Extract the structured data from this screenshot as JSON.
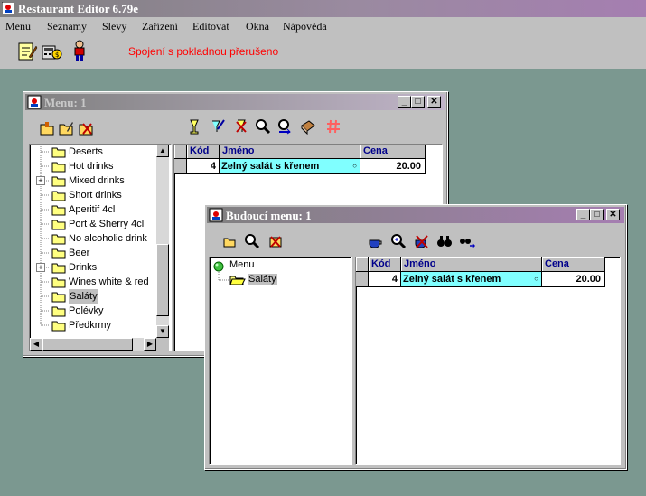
{
  "app": {
    "title": "Restaurant Editor 6.79e"
  },
  "menubar": [
    "Menu",
    "Seznamy",
    "Slevy",
    "Zařízení",
    "Editovat",
    "Okna",
    "Nápověda"
  ],
  "status_text": "Spojení s pokladnou přerušeno",
  "main_toolbar_icons": [
    "notepad-icon",
    "cash-register-icon",
    "user-icon"
  ],
  "menu_window": {
    "title": "Menu: 1",
    "tree": [
      {
        "label": "Deserts",
        "expandable": false
      },
      {
        "label": "Hot drinks",
        "expandable": false
      },
      {
        "label": "Mixed drinks",
        "expandable": true
      },
      {
        "label": "Short drinks",
        "expandable": false
      },
      {
        "label": "Aperitif 4cl",
        "expandable": false
      },
      {
        "label": "Port & Sherry 4cl",
        "expandable": false
      },
      {
        "label": "No alcoholic drink",
        "expandable": false
      },
      {
        "label": "Beer",
        "expandable": false
      },
      {
        "label": "Drinks",
        "expandable": true
      },
      {
        "label": "Wines white & red",
        "expandable": false
      },
      {
        "label": "Saláty",
        "expandable": false,
        "selected": true
      },
      {
        "label": "Polévky",
        "expandable": false
      },
      {
        "label": "Předkrmy",
        "expandable": false
      }
    ],
    "columns": [
      "Kód",
      "Jméno",
      "Cena"
    ],
    "rows": [
      {
        "kod": "4",
        "jmeno": "Zelný salát s křenem",
        "cena": "20.00"
      }
    ]
  },
  "future_window": {
    "title": "Budoucí menu: 1",
    "tree_root": "Menu",
    "tree_child": "Saláty",
    "columns": [
      "Kód",
      "Jméno",
      "Cena"
    ],
    "rows": [
      {
        "kod": "4",
        "jmeno": "Zelný salát s křenem",
        "cena": "20.00"
      }
    ]
  },
  "colors": {
    "desktop": "#7b9890",
    "status": "#ff0000",
    "selected_row": "#80ffff",
    "header_text": "#00008b"
  }
}
